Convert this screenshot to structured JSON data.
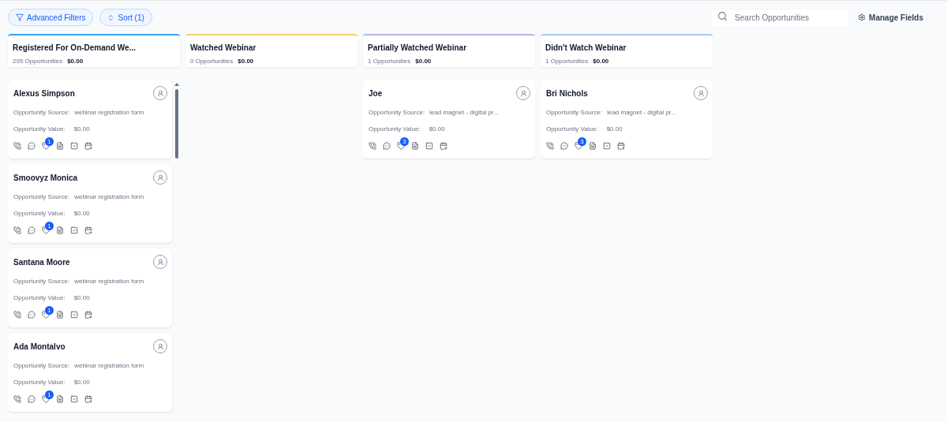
{
  "toolbar": {
    "filters_button": "Advanced Filters",
    "sort_button": "Sort (1)",
    "search": {
      "placeholder": "Search Opportunities"
    },
    "manage_fields": "Manage Fields"
  },
  "stages": [
    {
      "title": "Registered For On-Demand We...",
      "count": "295 Opportunities",
      "value": "$0.00",
      "color": "#3ba0f0",
      "scrollable": true,
      "cards": [
        {
          "name": "Alexus Simpson",
          "source_label": "Opportunity Source:",
          "source": "webinar registration form",
          "value_label": "Opportunity Value:",
          "value": "$0.00",
          "badge": "1"
        },
        {
          "name": "Smoovyz Monica",
          "source_label": "Opportunity Source:",
          "source": "webinar registration form",
          "value_label": "Opportunity Value:",
          "value": "$0.00",
          "badge": "1"
        },
        {
          "name": "Santana Moore",
          "source_label": "Opportunity Source:",
          "source": "webinar registration form",
          "value_label": "Opportunity Value:",
          "value": "$0.00",
          "badge": "1"
        },
        {
          "name": "Ada Montalvo",
          "source_label": "Opportunity Source:",
          "source": "webinar registration form",
          "value_label": "Opportunity Value:",
          "value": "$0.00",
          "badge": "1"
        }
      ]
    },
    {
      "title": "Watched Webinar",
      "count": "0 Opportunities",
      "value": "$0.00",
      "color": "#f2d06b",
      "scrollable": false
    },
    {
      "title": "Partially Watched Webinar",
      "count": "1 Opportunities",
      "value": "$0.00",
      "color": "#b7b3e3",
      "scrollable": false,
      "cards": [
        {
          "name": "Joe",
          "source_label": "Opportunity Source:",
          "source": "lead magnet - digital pr...",
          "value_label": "Opportunity Value:",
          "value": "$0.00",
          "badge": "3"
        }
      ]
    },
    {
      "title": "Didn't Watch Webinar",
      "count": "1 Opportunities",
      "value": "$0.00",
      "color": "#a9c8f3",
      "scrollable": false,
      "cards": [
        {
          "name": "Bri Nichols",
          "source_label": "Opportunity Source:",
          "source": "lead magnet - digital pr...",
          "value_label": "Opportunity Value:",
          "value": "$0.00",
          "badge": "3"
        }
      ]
    }
  ]
}
